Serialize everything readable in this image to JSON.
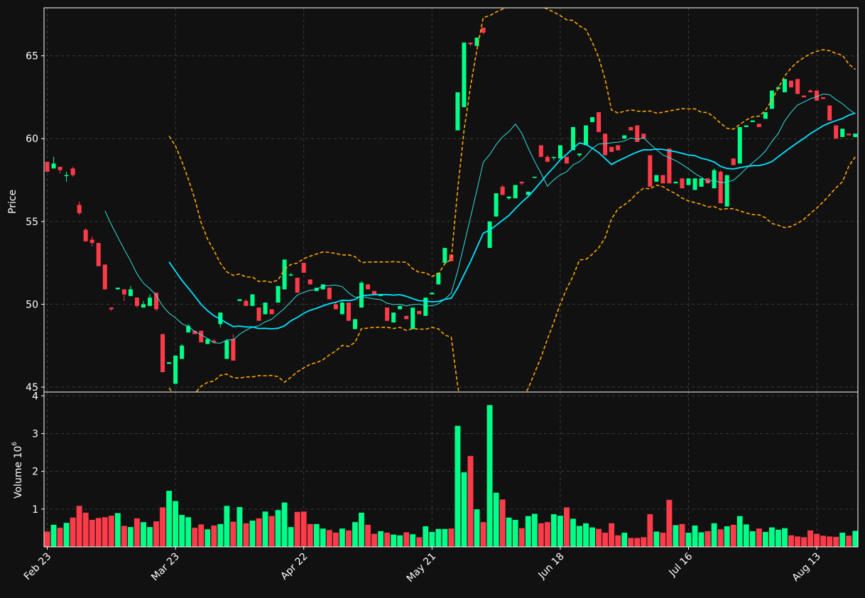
{
  "colors": {
    "background": "#111111",
    "panel_border": "#ffffff",
    "grid": "#3a3a3a",
    "up": "#00ff88",
    "down": "#ff3b4a",
    "mav_fast": "#33e0e0",
    "mav_slow": "#00e5ff",
    "bands": "#ffa500",
    "text": "#ffffff"
  },
  "chart_data": [
    {
      "type": "candlestick",
      "ylabel": "Price",
      "ylim": [
        44.7,
        67.9
      ],
      "yticks": [
        45,
        50,
        55,
        60,
        65
      ],
      "xticks": [
        {
          "label": "Feb 23",
          "index": 0
        },
        {
          "label": "Mar 23",
          "index": 20
        },
        {
          "label": "Apr 22",
          "index": 40
        },
        {
          "label": "May 21",
          "index": 60
        },
        {
          "label": "Jun 18",
          "index": 80
        },
        {
          "label": "Jul 16",
          "index": 100
        },
        {
          "label": "Aug 13",
          "index": 120
        }
      ],
      "grid": true,
      "moving_averages": [
        "mav_fast",
        "mav_slow"
      ],
      "bands": "upper/lower envelope (dashed)",
      "candles": [
        [
          58.6,
          58.6,
          58.0,
          58.0
        ],
        [
          58.2,
          58.9,
          58.2,
          58.5
        ],
        [
          58.3,
          58.3,
          57.9,
          58.1
        ],
        [
          57.8,
          58.0,
          57.4,
          57.8
        ],
        [
          58.2,
          58.3,
          57.7,
          57.8
        ],
        [
          56.0,
          56.2,
          55.4,
          55.5
        ],
        [
          54.5,
          54.6,
          53.8,
          53.8
        ],
        [
          53.9,
          54.1,
          53.5,
          53.7
        ],
        [
          53.7,
          53.7,
          52.4,
          52.3
        ],
        [
          52.4,
          52.4,
          50.9,
          50.9
        ],
        [
          49.8,
          49.8,
          49.6,
          49.7
        ],
        [
          50.9,
          50.9,
          50.9,
          51.0
        ],
        [
          50.9,
          50.9,
          50.2,
          50.6
        ],
        [
          50.5,
          51.1,
          50.5,
          50.9
        ],
        [
          50.4,
          50.4,
          49.8,
          49.9
        ],
        [
          49.8,
          50.2,
          49.8,
          50.0
        ],
        [
          49.9,
          50.6,
          49.9,
          50.4
        ],
        [
          50.7,
          50.7,
          49.6,
          49.7
        ],
        [
          48.2,
          48.2,
          45.9,
          45.9
        ],
        [
          46.4,
          46.4,
          46.4,
          46.5
        ],
        [
          45.2,
          46.9,
          45.2,
          46.9
        ],
        [
          46.7,
          47.6,
          46.7,
          47.5
        ],
        [
          48.3,
          48.8,
          48.3,
          48.7
        ],
        [
          48.4,
          48.4,
          48.2,
          48.2
        ],
        [
          48.4,
          48.4,
          47.7,
          47.7
        ],
        [
          47.6,
          47.9,
          47.6,
          47.9
        ],
        [
          47.8,
          47.9,
          47.7,
          47.7
        ],
        [
          48.8,
          48.8,
          48.6,
          49.5
        ],
        [
          46.7,
          47.9,
          46.7,
          47.8
        ],
        [
          47.9,
          48.2,
          46.6,
          46.6
        ],
        [
          50.2,
          50.2,
          50.2,
          50.3
        ],
        [
          50.2,
          50.3,
          49.9,
          49.9
        ],
        [
          49.9,
          50.6,
          49.9,
          50.6
        ],
        [
          49.8,
          49.8,
          49.0,
          49.0
        ],
        [
          49.4,
          50.1,
          49.4,
          50.1
        ],
        [
          49.7,
          49.7,
          49.4,
          49.4
        ],
        [
          50.1,
          51.0,
          50.1,
          51.1
        ],
        [
          50.9,
          51.1,
          50.9,
          52.7
        ],
        [
          51.8,
          51.9,
          51.7,
          51.8
        ],
        [
          51.6,
          51.6,
          50.7,
          50.7
        ],
        [
          52.5,
          52.5,
          51.9,
          51.9
        ],
        [
          51.5,
          51.5,
          51.2,
          51.2
        ],
        [
          50.8,
          51.0,
          50.8,
          51.0
        ],
        [
          50.9,
          51.2,
          50.9,
          51.2
        ],
        [
          51.0,
          51.0,
          50.3,
          50.3
        ],
        [
          50.0,
          50.1,
          49.7,
          49.7
        ],
        [
          49.4,
          50.2,
          49.4,
          50.1
        ],
        [
          50.1,
          50.1,
          49.0,
          49.0
        ],
        [
          48.5,
          49.1,
          48.5,
          49.1
        ],
        [
          49.8,
          51.4,
          49.8,
          51.3
        ],
        [
          51.2,
          51.2,
          50.9,
          50.9
        ],
        [
          50.8,
          50.8,
          50.6,
          50.6
        ],
        [
          50.5,
          50.6,
          50.5,
          50.6
        ],
        [
          49.8,
          49.8,
          49.0,
          49.0
        ],
        [
          48.9,
          49.5,
          48.9,
          49.5
        ],
        [
          49.7,
          49.9,
          49.7,
          49.9
        ],
        [
          49.3,
          49.3,
          49.1,
          49.1
        ],
        [
          48.5,
          49.8,
          48.5,
          49.8
        ],
        [
          49.6,
          49.6,
          49.4,
          49.4
        ],
        [
          49.3,
          50.3,
          49.3,
          50.4
        ],
        [
          50.6,
          50.7,
          50.6,
          50.7
        ],
        [
          51.2,
          51.9,
          51.2,
          51.9
        ],
        [
          52.5,
          53.4,
          52.5,
          53.4
        ],
        [
          53.0,
          53.0,
          52.6,
          52.6
        ],
        [
          60.5,
          62.8,
          60.5,
          62.8
        ],
        [
          61.9,
          65.8,
          61.9,
          65.8
        ],
        [
          65.8,
          65.8,
          65.6,
          65.7
        ],
        [
          65.6,
          66.1,
          65.6,
          66.1
        ],
        [
          66.7,
          66.7,
          66.3,
          66.4
        ],
        [
          53.4,
          55.0,
          53.4,
          55.0
        ],
        [
          55.3,
          56.7,
          55.3,
          56.7
        ],
        [
          57.1,
          57.2,
          56.7,
          56.6
        ],
        [
          56.4,
          56.4,
          56.3,
          56.5
        ],
        [
          56.4,
          57.2,
          56.4,
          57.2
        ],
        [
          57.4,
          57.4,
          57.2,
          57.3
        ],
        [
          56.6,
          56.6,
          56.9,
          56.8
        ],
        [
          57.7,
          57.7,
          57.6,
          57.7
        ],
        [
          59.6,
          59.6,
          58.9,
          58.9
        ],
        [
          58.9,
          59.0,
          58.6,
          58.6
        ],
        [
          58.9,
          58.9,
          58.7,
          58.9
        ],
        [
          58.8,
          59.6,
          58.8,
          59.6
        ],
        [
          58.9,
          58.9,
          58.5,
          58.5
        ],
        [
          59.3,
          60.7,
          59.3,
          60.7
        ],
        [
          59.0,
          59.0,
          58.9,
          59.1
        ],
        [
          59.6,
          60.8,
          59.6,
          60.8
        ],
        [
          61.0,
          61.3,
          61.0,
          61.3
        ],
        [
          61.6,
          61.6,
          60.4,
          60.4
        ],
        [
          60.3,
          60.3,
          59.0,
          59.0
        ],
        [
          59.5,
          59.5,
          59.2,
          59.2
        ],
        [
          59.6,
          59.6,
          59.3,
          59.3
        ],
        [
          60.0,
          60.2,
          60.0,
          60.2
        ],
        [
          60.7,
          60.7,
          60.5,
          60.5
        ],
        [
          60.8,
          60.8,
          59.8,
          59.8
        ],
        [
          60.3,
          60.3,
          60.0,
          60.0
        ],
        [
          59.0,
          59.0,
          57.1,
          57.1
        ],
        [
          57.4,
          57.8,
          57.4,
          57.8
        ],
        [
          57.8,
          57.8,
          57.3,
          57.3
        ],
        [
          59.4,
          59.4,
          57.3,
          57.3
        ],
        [
          57.3,
          57.3,
          57.3,
          57.4
        ],
        [
          57.6,
          57.6,
          57.0,
          57.0
        ],
        [
          57.2,
          57.6,
          57.2,
          57.6
        ],
        [
          56.9,
          57.6,
          56.9,
          57.6
        ],
        [
          57.1,
          57.6,
          57.1,
          57.6
        ],
        [
          57.6,
          57.6,
          57.3,
          57.3
        ],
        [
          57.0,
          58.2,
          57.0,
          58.1
        ],
        [
          58.0,
          58.1,
          56.1,
          56.1
        ],
        [
          55.9,
          57.8,
          55.9,
          57.8
        ],
        [
          58.8,
          58.8,
          58.4,
          58.4
        ],
        [
          58.5,
          60.7,
          58.5,
          60.7
        ],
        [
          60.7,
          60.8,
          60.7,
          60.8
        ],
        [
          61.0,
          61.1,
          61.0,
          61.1
        ],
        [
          60.9,
          60.9,
          60.7,
          60.7
        ],
        [
          61.2,
          61.6,
          61.2,
          61.6
        ],
        [
          61.8,
          62.9,
          61.8,
          62.9
        ],
        [
          63.0,
          63.2,
          63.0,
          63.1
        ],
        [
          62.8,
          63.6,
          62.8,
          63.6
        ],
        [
          63.5,
          63.5,
          63.1,
          63.1
        ],
        [
          63.6,
          63.6,
          62.7,
          62.7
        ],
        [
          62.6,
          62.6,
          62.5,
          62.5
        ],
        [
          62.9,
          63.0,
          62.8,
          62.8
        ],
        [
          62.9,
          62.9,
          62.3,
          62.3
        ],
        [
          62.5,
          62.5,
          62.4,
          62.4
        ],
        [
          62.0,
          62.0,
          61.1,
          61.1
        ],
        [
          60.8,
          60.8,
          60.0,
          60.0
        ],
        [
          60.1,
          60.6,
          60.1,
          60.6
        ],
        [
          60.3,
          60.3,
          60.2,
          60.2
        ],
        [
          60.1,
          60.3,
          60.1,
          60.3
        ]
      ]
    },
    {
      "type": "bar",
      "ylabel": "Volume  10",
      "ylabel_exponent": "6",
      "ylim": [
        0.0,
        4.1
      ],
      "yticks": [
        1,
        2,
        3,
        4
      ],
      "grid": true,
      "values": [
        0.41,
        0.59,
        0.51,
        0.64,
        0.78,
        1.09,
        0.91,
        0.72,
        0.77,
        0.79,
        0.83,
        0.9,
        0.56,
        0.53,
        0.76,
        0.66,
        0.53,
        0.68,
        1.05,
        1.49,
        1.22,
        0.85,
        0.79,
        0.51,
        0.6,
        0.47,
        0.57,
        0.61,
        1.09,
        0.67,
        1.06,
        0.63,
        0.7,
        0.76,
        0.94,
        0.82,
        0.98,
        1.18,
        0.53,
        0.93,
        0.94,
        0.61,
        0.61,
        0.49,
        0.45,
        0.38,
        0.49,
        0.44,
        0.66,
        0.91,
        0.59,
        0.35,
        0.42,
        0.38,
        0.33,
        0.31,
        0.39,
        0.34,
        0.26,
        0.55,
        0.4,
        0.48,
        0.48,
        0.49,
        3.21,
        1.98,
        2.41,
        1.0,
        0.66,
        3.76,
        1.44,
        1.26,
        0.78,
        0.72,
        0.5,
        0.82,
        0.88,
        0.63,
        0.66,
        0.87,
        0.83,
        1.05,
        0.75,
        0.56,
        0.63,
        0.52,
        0.48,
        0.38,
        0.63,
        0.31,
        0.38,
        0.24,
        0.24,
        0.26,
        0.87,
        0.41,
        0.38,
        1.25,
        0.58,
        0.61,
        0.38,
        0.57,
        0.39,
        0.42,
        0.63,
        0.47,
        0.55,
        0.59,
        0.82,
        0.6,
        0.42,
        0.49,
        0.4,
        0.52,
        0.46,
        0.5,
        0.31,
        0.28,
        0.26,
        0.44,
        0.35,
        0.3,
        0.28,
        0.27,
        0.38,
        0.3,
        0.43
      ]
    }
  ]
}
